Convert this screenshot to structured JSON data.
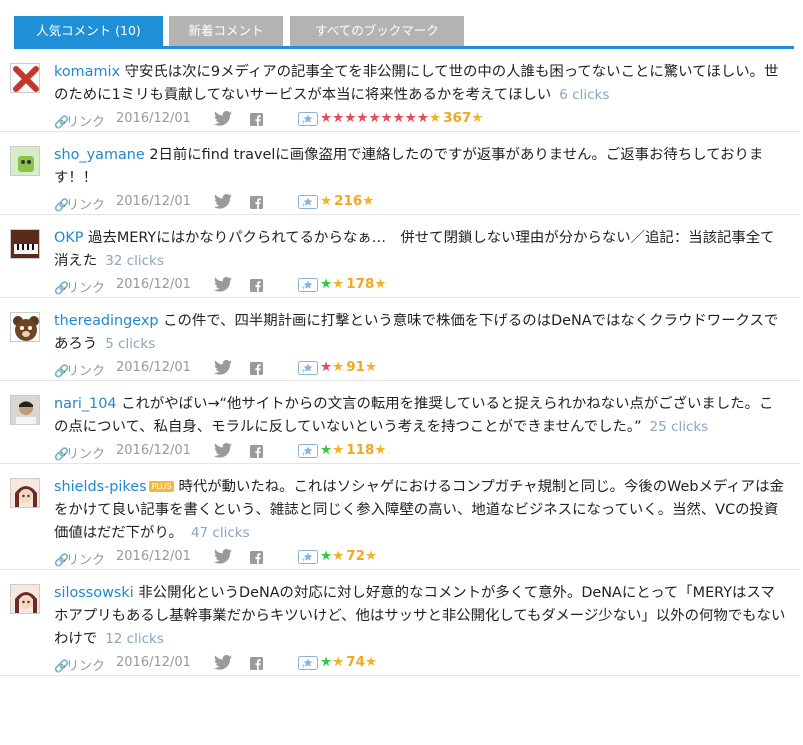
{
  "tabs": [
    {
      "label": "人気コメント (10)",
      "active": true
    },
    {
      "label": "新着コメント",
      "active": false
    },
    {
      "label": "すべてのブックマーク",
      "active": false
    }
  ],
  "link_label": "リンク",
  "comments": [
    {
      "user": "komamix",
      "plus": false,
      "text": "守安氏は次に9メディアの記事全てを非公開にして世の中の人誰も困ってないことに驚いてほしい。世のために1ミリも貢献してないサービスが本当に将来性あるかを考えてほしい",
      "clicks": "6 clicks",
      "date": "2016/12/01",
      "stars": {
        "red": 9,
        "green": 0
      },
      "star_count": "367",
      "avatar_icon": "red-x-icon"
    },
    {
      "user": "sho_yamane",
      "plus": false,
      "text": "2日前にfind travelに画像盗用で連絡したのですが返事がありません。ご返事お待ちしております！！",
      "clicks": "",
      "date": "2016/12/01",
      "stars": {
        "red": 0,
        "green": 0
      },
      "star_count": "216",
      "avatar_icon": "green-character-icon"
    },
    {
      "user": "OKP",
      "plus": false,
      "text": "過去MERYにはかなりパクられてるからなぁ…　併せて閉鎖しない理由が分からない／追記：当該記事全て消えた",
      "clicks": "32 clicks",
      "date": "2016/12/01",
      "stars": {
        "red": 0,
        "green": 1
      },
      "star_count": "178",
      "avatar_icon": "piano-icon"
    },
    {
      "user": "thereadingexp",
      "plus": false,
      "text": "この件で、四半期計画に打撃という意味で株価を下げるのはDeNAではなくクラウドワークスであろう",
      "clicks": "5 clicks",
      "date": "2016/12/01",
      "stars": {
        "red": 1,
        "green": 0
      },
      "star_count": "91",
      "avatar_icon": "bear-icon"
    },
    {
      "user": "nari_104",
      "plus": false,
      "text": "これがやばい→“他サイトからの文言の転用を推奨していると捉えられかねない点がございました。この点について、私自身、モラルに反していないという考えを持つことができませんでした。”",
      "clicks": "25 clicks",
      "date": "2016/12/01",
      "stars": {
        "red": 0,
        "green": 1
      },
      "star_count": "118",
      "avatar_icon": "person-photo-icon"
    },
    {
      "user": "shields-pikes",
      "plus": true,
      "plus_label": "PLUS",
      "text": "時代が動いたね。これはソシャゲにおけるコンプガチャ規制と同じ。今後のWebメディアは金をかけて良い記事を書くという、雑誌と同じく参入障壁の高い、地道なビジネスになっていく。当然、VCの投資価値はだだ下がり。",
      "clicks": "47 clicks",
      "date": "2016/12/01",
      "stars": {
        "red": 0,
        "green": 1
      },
      "star_count": "72",
      "avatar_icon": "anime-face-icon"
    },
    {
      "user": "silossowski",
      "plus": false,
      "text": "非公開化というDeNAの対応に対し好意的なコメントが多くて意外。DeNAにとって「MERYはスマホアプリもあるし基幹事業だからキツいけど、他はサッサと非公開化してもダメージ少ない」以外の何物でもないわけで",
      "clicks": "12 clicks",
      "date": "2016/12/01",
      "stars": {
        "red": 0,
        "green": 1
      },
      "star_count": "74",
      "avatar_icon": "anime-face-icon"
    }
  ],
  "colors": {
    "accent": "#1f8fd8",
    "user": "#2288cc",
    "star_yellow": "#f0b429",
    "star_red": "#e74c5b",
    "star_green": "#2ecc40"
  }
}
